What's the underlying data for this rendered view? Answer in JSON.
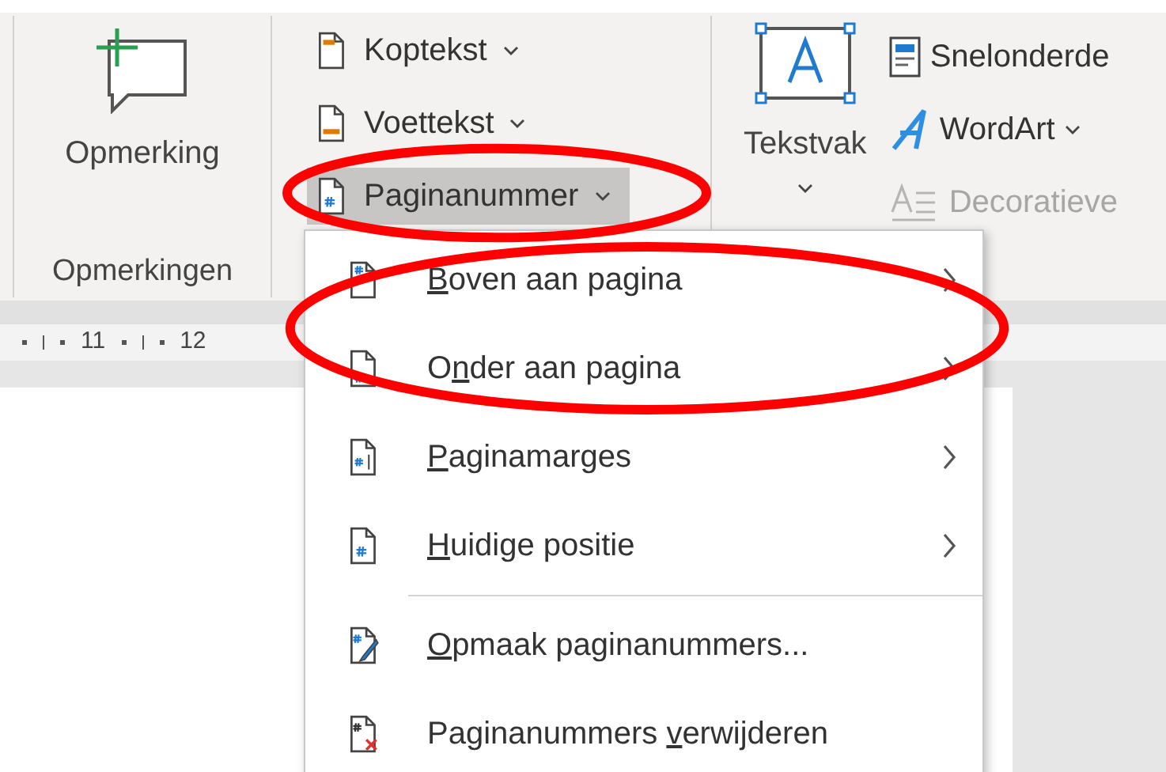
{
  "comments_group": {
    "button": {
      "label": "Opmerking"
    },
    "label": "Opmerkingen"
  },
  "header_footer_group": {
    "buttons": [
      {
        "label": "Koptekst",
        "dropdown": true,
        "selected": false,
        "highlighted": false
      },
      {
        "label": "Voettekst",
        "dropdown": true,
        "selected": false,
        "highlighted": false
      },
      {
        "label": "Paginanummer",
        "dropdown": true,
        "selected": true,
        "highlighted": true
      }
    ]
  },
  "text_group": {
    "large_button": {
      "label": "Tekstvak",
      "dropdown": true
    },
    "buttons": [
      {
        "label": "Snelonderde",
        "dropdown": false,
        "disabled": false
      },
      {
        "label": "WordArt",
        "dropdown": true,
        "disabled": false
      },
      {
        "label": "Decoratieve",
        "dropdown": false,
        "disabled": true
      }
    ]
  },
  "ruler": {
    "labels": [
      "11",
      "12"
    ]
  },
  "menu": {
    "items": [
      {
        "key": "B",
        "after": "oven aan pagina",
        "submenu": true,
        "highlighted": true,
        "separator_before": false
      },
      {
        "before": "O",
        "key": "n",
        "after": "der aan pagina",
        "submenu": true,
        "highlighted": true,
        "separator_before": false
      },
      {
        "key": "P",
        "after": "aginamarges",
        "submenu": true,
        "highlighted": false,
        "separator_before": false
      },
      {
        "key": "H",
        "after": "uidige positie",
        "submenu": true,
        "highlighted": false,
        "separator_before": false
      },
      {
        "key": "O",
        "after": "pmaak paginanummers...",
        "submenu": false,
        "highlighted": false,
        "separator_before": true
      },
      {
        "before": "Paginanummers ",
        "key": "v",
        "after": "erwijderen",
        "submenu": false,
        "highlighted": false,
        "separator_before": false
      }
    ]
  }
}
